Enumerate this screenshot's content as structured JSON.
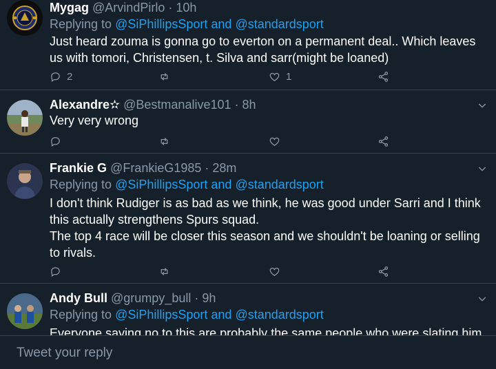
{
  "tweets": [
    {
      "display_name": "Mygag",
      "handle": "@ArvindPirlo",
      "time": "· 10h",
      "replying_prefix": "Replying to ",
      "mention1": "@SiPhillipsSport",
      "mention_and": " and ",
      "mention2": "@standardsport",
      "body_lines": [
        "Just heard zouma is gonna go to everton on a permanent deal.. Which leaves",
        "us with tomori, Christensen,  t. Silva and sarr(might be loaned)"
      ],
      "reply_count": "2",
      "retweet_count": "",
      "like_count": "1"
    },
    {
      "display_name": "Alexandre✫",
      "handle": "@Bestmanalive101",
      "time": "· 8h",
      "body_lines": [
        "Very very wrong"
      ],
      "reply_count": "",
      "retweet_count": "",
      "like_count": ""
    },
    {
      "display_name": "Frankie G",
      "handle": "@FrankieG1985",
      "time": "· 28m",
      "replying_prefix": "Replying to ",
      "mention1": "@SiPhillipsSport",
      "mention_and": " and ",
      "mention2": "@standardsport",
      "body_lines": [
        "I don't think Rudiger is as bad as we think, he was good under Sarri and I think",
        "this actually strengthens Spurs squad.",
        "The top 4 race will be closer this season and we shouldn't be loaning or selling",
        "to rivals."
      ],
      "reply_count": "",
      "retweet_count": "",
      "like_count": ""
    },
    {
      "display_name": "Andy Bull",
      "handle": "@grumpy_bull",
      "time": "· 9h",
      "replying_prefix": "Replying to ",
      "mention1": "@SiPhillipsSport",
      "mention_and": " and ",
      "mention2": "@standardsport",
      "body_lines": [
        "Everyone saying no to this are probably the same people who were slating him"
      ]
    }
  ],
  "icons": {
    "reply": "reply-icon",
    "retweet": "retweet-icon",
    "like": "heart-icon",
    "share": "share-icon",
    "menu": "chevron-down-icon"
  },
  "composer": {
    "placeholder": "Tweet your reply"
  },
  "colors": {
    "background": "#15202b",
    "link": "#1da1f2",
    "secondary": "#8899a6",
    "divider": "#38444d"
  }
}
